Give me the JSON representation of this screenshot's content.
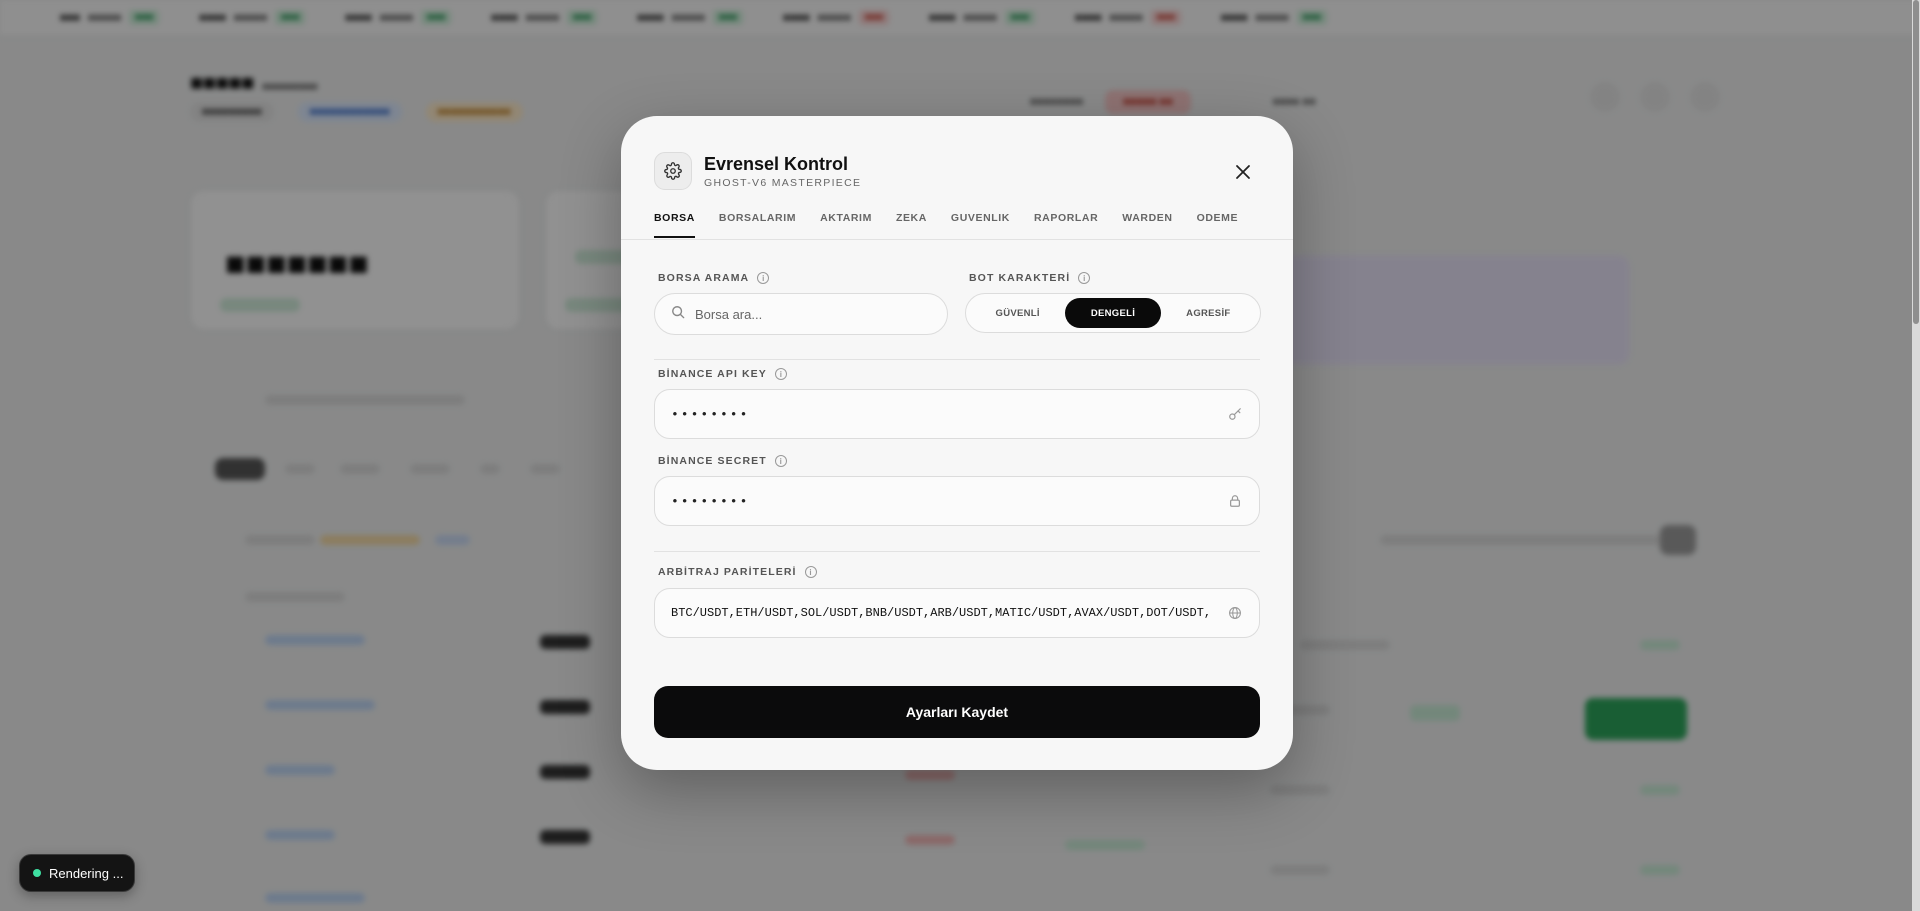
{
  "modal": {
    "title": "Evrensel Kontrol",
    "subtitle": "GHOST-V6 MASTERPIECE",
    "tabs": [
      {
        "label": "BORSA",
        "active": true
      },
      {
        "label": "BORSALARIM",
        "active": false
      },
      {
        "label": "AKTARIM",
        "active": false
      },
      {
        "label": "ZEKA",
        "active": false
      },
      {
        "label": "GUVENLIK",
        "active": false
      },
      {
        "label": "RAPORLAR",
        "active": false
      },
      {
        "label": "WARDEN",
        "active": false
      },
      {
        "label": "ODEME",
        "active": false
      }
    ],
    "exchange_search": {
      "label": "BORSA ARAMA",
      "placeholder": "Borsa ara..."
    },
    "bot_character": {
      "label": "BOT KARAKTERİ",
      "options": [
        "GÜVENLİ",
        "DENGELİ",
        "AGRESİF"
      ],
      "selected": "DENGELİ"
    },
    "api_key": {
      "label": "BİNANCE API KEY",
      "value": "••••••••",
      "icon": "key-icon"
    },
    "secret": {
      "label": "BİNANCE SECRET",
      "value": "••••••••",
      "icon": "lock-icon"
    },
    "arbitrage_pairs": {
      "label": "ARBİTRAJ PARİTELERİ",
      "value": "BTC/USDT,ETH/USDT,SOL/USDT,BNB/USDT,ARB/USDT,MATIC/USDT,AVAX/USDT,DOT/USDT,",
      "icon": "globe-icon"
    },
    "save_label": "Ayarları Kaydet"
  },
  "toast": {
    "text": "Rendering ..."
  },
  "colors": {
    "accent": "#0a0a0a",
    "toast_dot": "#3fe0a2",
    "overlay": "rgba(0,0,0,0.42)"
  }
}
